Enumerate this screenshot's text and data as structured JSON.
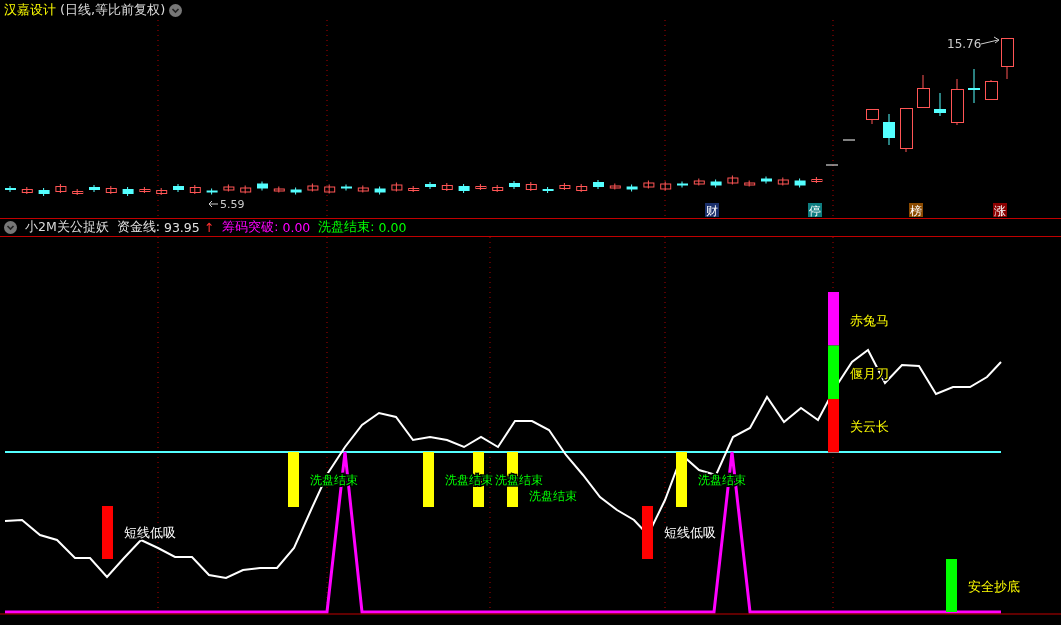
{
  "title": {
    "name": "汉嘉设计",
    "mode": "(日线,等比前复权)"
  },
  "price_chart": {
    "high_label": "15.76",
    "low_label": "5.59",
    "events": [
      {
        "text": "财",
        "color": "#1a2f6b"
      },
      {
        "text": "停",
        "color": "#0e7d80"
      },
      {
        "text": "榜",
        "color": "#8a4a00"
      },
      {
        "text": "涨",
        "color": "#8b0000"
      }
    ]
  },
  "indicator": {
    "name": "小2M关公捉妖",
    "fields": [
      {
        "label": "资金线:",
        "value": "93.95",
        "trend": "↑"
      },
      {
        "label": "筹码突破:",
        "value": "0.00"
      },
      {
        "label": "洗盘结束:",
        "value": "0.00"
      }
    ]
  },
  "signals": [
    {
      "kind": "low-buy",
      "label": "短线低吸"
    },
    {
      "kind": "wash",
      "label": "洗盘结束"
    },
    {
      "kind": "wash",
      "label": "洗盘结束"
    },
    {
      "kind": "wash",
      "label": "洗盘结束"
    },
    {
      "kind": "wash",
      "label": "洗盘结束"
    },
    {
      "kind": "low-buy",
      "label": "短线低吸"
    },
    {
      "kind": "wash",
      "label": "洗盘结束"
    },
    {
      "kind": "tiers",
      "labels": [
        "赤兔马",
        "偃月刀",
        "关云长"
      ]
    },
    {
      "kind": "bottom",
      "label": "安全抄底"
    }
  ]
}
